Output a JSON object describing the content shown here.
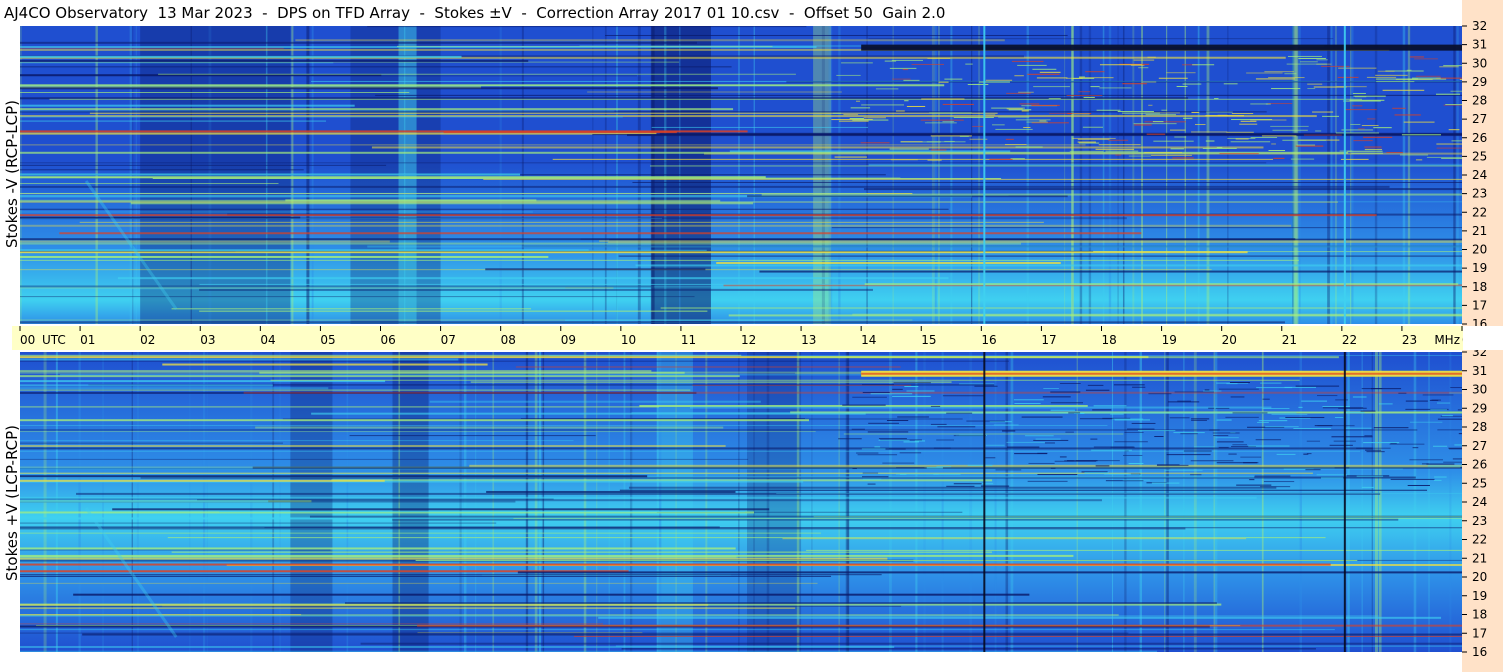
{
  "title": "AJ4CO Observatory  13 Mar 2023  -  DPS on TFD Array  -  Stokes ±V  -  Correction Array 2017 01 10.csv  -  Offset 50  Gain 2.0",
  "chart_data": [
    {
      "type": "heatmap",
      "panel": "top",
      "ylabel": "Stokes -V (RCP-LCP)",
      "x_unit": "UTC",
      "y_unit": "MHz",
      "xlim_hours": [
        0,
        24
      ],
      "ylim_mhz": [
        16,
        32
      ],
      "x_ticks": [
        "00",
        "01",
        "02",
        "03",
        "04",
        "05",
        "06",
        "07",
        "08",
        "09",
        "10",
        "11",
        "12",
        "13",
        "14",
        "15",
        "16",
        "17",
        "18",
        "19",
        "20",
        "21",
        "22",
        "23",
        "00"
      ],
      "y_ticks": [
        16,
        17,
        18,
        19,
        20,
        21,
        22,
        23,
        24,
        25,
        26,
        27,
        28,
        29,
        30,
        31,
        32
      ],
      "colormap": [
        "#0a1a6a",
        "#1f4fd0",
        "#2e8fe8",
        "#3fd0f0",
        "#a8f07a",
        "#f0e040",
        "#e04020"
      ],
      "grid": false
    },
    {
      "type": "heatmap",
      "panel": "bottom",
      "ylabel": "Stokes +V (LCP-RCP)",
      "x_unit": "UTC",
      "y_unit": "MHz",
      "xlim_hours": [
        0,
        24
      ],
      "ylim_mhz": [
        16,
        32
      ],
      "x_ticks": [
        "00",
        "01",
        "02",
        "03",
        "04",
        "05",
        "06",
        "07",
        "08",
        "09",
        "10",
        "11",
        "12",
        "13",
        "14",
        "15",
        "16",
        "17",
        "18",
        "19",
        "20",
        "21",
        "22",
        "23",
        "00"
      ],
      "y_ticks": [
        16,
        17,
        18,
        19,
        20,
        21,
        22,
        23,
        24,
        25,
        26,
        27,
        28,
        29,
        30,
        31,
        32
      ],
      "colormap": [
        "#0a1a6a",
        "#1f4fd0",
        "#2e8fe8",
        "#3fd0f0",
        "#a8f07a",
        "#f0e040",
        "#e04020"
      ],
      "grid": false
    }
  ],
  "axis": {
    "utc_label": "UTC",
    "mhz_label": "MHz"
  },
  "colors": {
    "time_axis_bg": "#ffffc6",
    "mhz_axis_bg": "#ffe2c8",
    "dark": "#0a1a6a",
    "base": "#1f4fd0",
    "mid": "#2e8fe8",
    "light": "#3fd0f0",
    "green": "#a8f07a",
    "yellow": "#f0e040",
    "red": "#e04020"
  }
}
